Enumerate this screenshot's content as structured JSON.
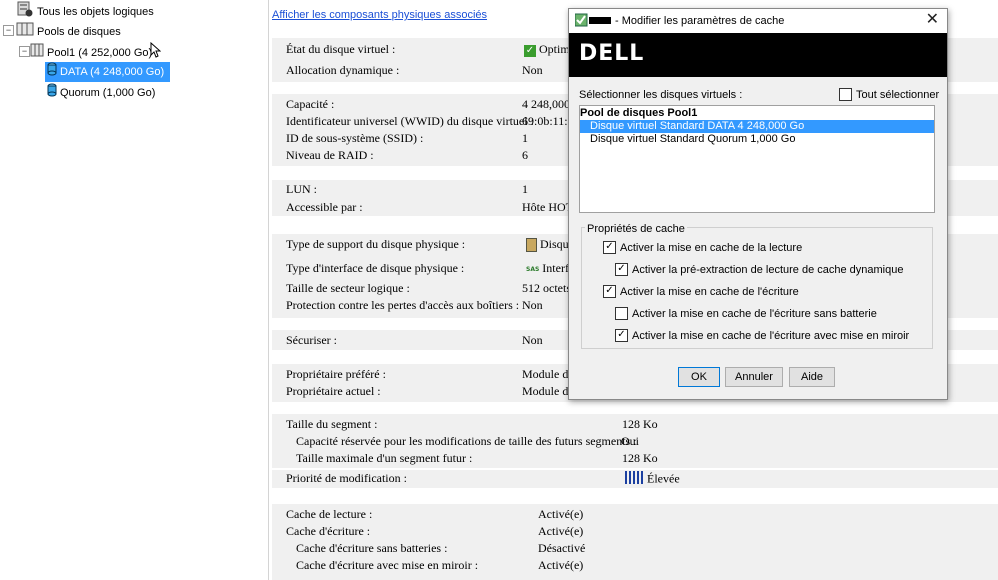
{
  "tree": {
    "all_objects": "Tous les objets logiques",
    "pools": "Pools de disques",
    "pool1": "Pool1 (4 252,000 Go)",
    "data": "DATA (4 248,000 Go)",
    "quorum": "Quorum (1,000 Go)"
  },
  "props": {
    "link": "Afficher les composants physiques associés",
    "rows": [
      {
        "label": "État du disque virtuel :",
        "value": "Optim"
      },
      {
        "label": "Allocation dynamique :",
        "value": "Non"
      },
      {
        "label": "Capacité :",
        "value": "4 248,000"
      },
      {
        "label": "Identificateur universel (WWID) du disque virtuel :",
        "value": "69:0b:11:c"
      },
      {
        "label": "ID de sous-système (SSID) :",
        "value": "1"
      },
      {
        "label": "Niveau de RAID :",
        "value": "6"
      },
      {
        "label": "LUN :",
        "value": "1"
      },
      {
        "label": "Accessible par :",
        "value": "Hôte HOT"
      },
      {
        "label": "Type de support du disque physique :",
        "value": "Disqu"
      },
      {
        "label": "Type d'interface de disque physique :",
        "value": "Interf"
      },
      {
        "label": "Taille de secteur logique :",
        "value": "512 octets"
      },
      {
        "label": "Protection contre les pertes d'accès aux boîtiers :",
        "value": "Non"
      },
      {
        "label": "Sécuriser :",
        "value": "Non"
      },
      {
        "label": "Propriétaire préféré :",
        "value": "Module de"
      },
      {
        "label": "Propriétaire actuel :",
        "value": "Module de"
      },
      {
        "label": "Taille du segment :",
        "value": "128 Ko"
      },
      {
        "label": "Capacité réservée pour les modifications de taille des futurs segments :",
        "value": "Oui"
      },
      {
        "label": "Taille maximale d'un segment futur :",
        "value": "128 Ko"
      },
      {
        "label": "Priorité de modification :",
        "value": "Élevée"
      },
      {
        "label": "Cache de lecture :",
        "value": "Activé(e)"
      },
      {
        "label": "Cache d'écriture :",
        "value": "Activé(e)"
      },
      {
        "label": "Cache d'écriture sans batteries :",
        "value": "Désactivé"
      },
      {
        "label": "Cache d'écriture avec mise en miroir :",
        "value": "Activé(e)"
      }
    ],
    "sas_badge": "SAS"
  },
  "dialog": {
    "title": "- Modifier les paramètres de cache",
    "close": "✕",
    "logo": "DELL",
    "select_label": "Sélectionner les disques virtuels :",
    "select_all": "Tout sélectionner",
    "list_header": "Pool de disques Pool1",
    "list_items": [
      "Disque virtuel Standard  DATA  4 248,000 Go",
      "Disque virtuel Standard  Quorum  1,000 Go"
    ],
    "group_title": "Propriétés de cache",
    "options": [
      {
        "label": "Activer la mise en cache de la lecture",
        "checked": true
      },
      {
        "label": "Activer la pré-extraction de lecture de cache dynamique",
        "checked": true
      },
      {
        "label": "Activer la mise en cache de l'écriture",
        "checked": true
      },
      {
        "label": "Activer la mise en cache de l'écriture sans batterie",
        "checked": false
      },
      {
        "label": "Activer la mise en cache de l'écriture avec mise en miroir",
        "checked": true
      }
    ],
    "ok": "OK",
    "cancel": "Annuler",
    "help": "Aide"
  },
  "colors": {
    "selection": "#3399ff",
    "link": "#1a4fd6",
    "banner": "#000000"
  }
}
